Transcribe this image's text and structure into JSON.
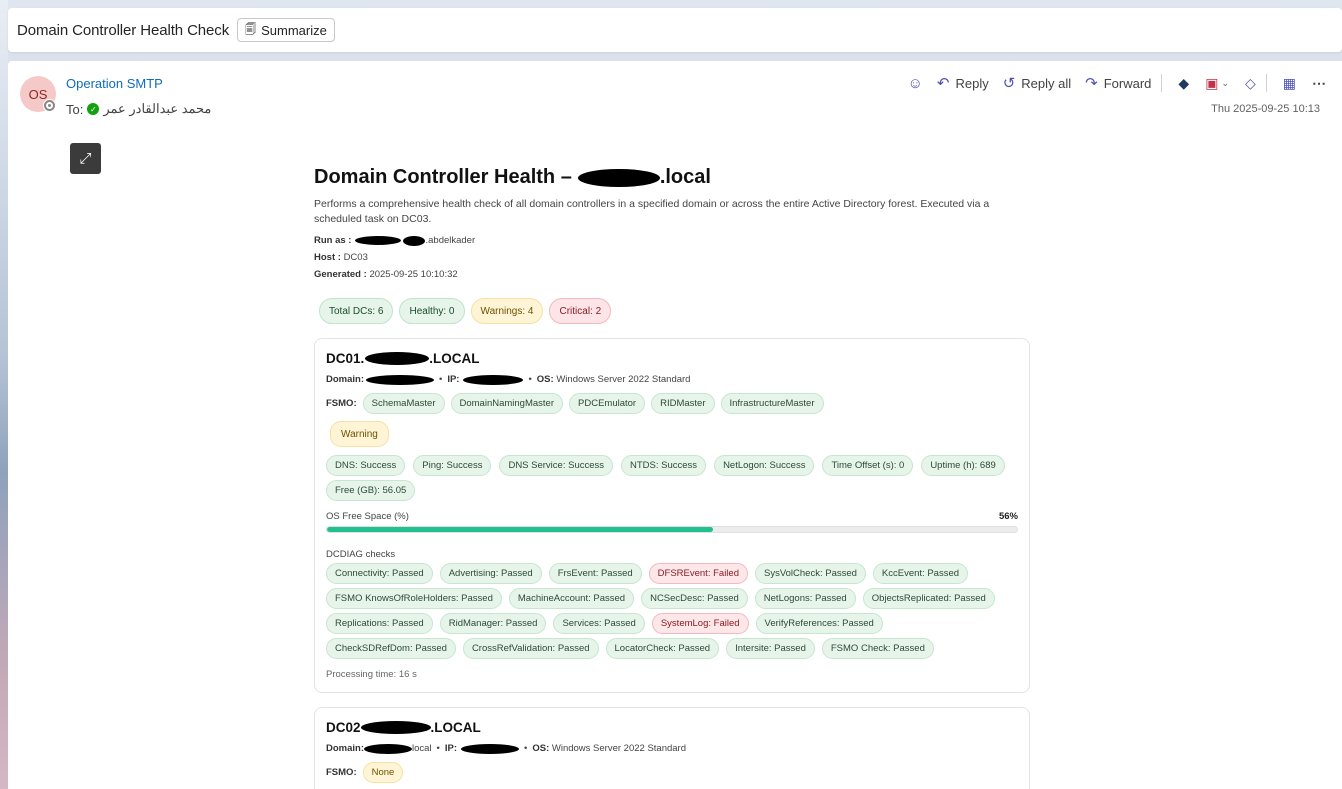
{
  "subject": "Domain Controller Health Check",
  "summarize_label": "Summarize",
  "sender": {
    "initials": "OS",
    "name": "Operation SMTP"
  },
  "to": {
    "label": "To:",
    "recipient": "محمد عبدالقادر عمر"
  },
  "date": "Thu 2025-09-25 10:13",
  "actions": {
    "reply": "Reply",
    "reply_all": "Reply all",
    "forward": "Forward"
  },
  "report": {
    "title_prefix": "Domain Controller Health –",
    "title_suffix": ".local",
    "description": "Performs a comprehensive health check of all domain controllers in a specified domain or across the entire Active Directory forest. Executed via a scheduled task on DC03.",
    "run_as_label": "Run as :",
    "run_as_suffix": ".abdelkader",
    "host_label": "Host :",
    "host": "DC03",
    "generated_label": "Generated :",
    "generated": "2025-09-25 10:10:32"
  },
  "summary": {
    "total": "Total DCs: 6",
    "healthy": "Healthy: 0",
    "warnings": "Warnings: 4",
    "critical": "Critical: 2"
  },
  "dc1": {
    "name_prefix": "DC01.",
    "name_suffix": ".LOCAL",
    "domain_label": "Domain:",
    "ip_label": "IP:",
    "os_label": "OS:",
    "os": "Windows Server 2022 Standard",
    "fsmo_label": "FSMO:",
    "fsmo": [
      "SchemaMaster",
      "DomainNamingMaster",
      "PDCEmulator",
      "RIDMaster",
      "InfrastructureMaster"
    ],
    "status": "Warning",
    "checks": [
      "DNS: Success",
      "Ping: Success",
      "DNS Service: Success",
      "NTDS: Success",
      "NetLogon: Success",
      "Time Offset (s): 0",
      "Uptime (h): 689",
      "Free (GB): 56.05"
    ],
    "free_space_label": "OS Free Space (%)",
    "free_space_text": "56%",
    "free_space_pct": 56,
    "dcdiag_label": "DCDIAG checks",
    "dcdiag": [
      {
        "text": "Connectivity: Passed",
        "state": "pass"
      },
      {
        "text": "Advertising: Passed",
        "state": "pass"
      },
      {
        "text": "FrsEvent: Passed",
        "state": "pass"
      },
      {
        "text": "DFSREvent: Failed",
        "state": "fail"
      },
      {
        "text": "SysVolCheck: Passed",
        "state": "pass"
      },
      {
        "text": "KccEvent: Passed",
        "state": "pass"
      },
      {
        "text": "FSMO KnowsOfRoleHolders: Passed",
        "state": "pass"
      },
      {
        "text": "MachineAccount: Passed",
        "state": "pass"
      },
      {
        "text": "NCSecDesc: Passed",
        "state": "pass"
      },
      {
        "text": "NetLogons: Passed",
        "state": "pass"
      },
      {
        "text": "ObjectsReplicated: Passed",
        "state": "pass"
      },
      {
        "text": "Replications: Passed",
        "state": "pass"
      },
      {
        "text": "RidManager: Passed",
        "state": "pass"
      },
      {
        "text": "Services: Passed",
        "state": "pass"
      },
      {
        "text": "SystemLog: Failed",
        "state": "fail"
      },
      {
        "text": "VerifyReferences: Passed",
        "state": "pass"
      },
      {
        "text": "CheckSDRefDom: Passed",
        "state": "pass"
      },
      {
        "text": "CrossRefValidation: Passed",
        "state": "pass"
      },
      {
        "text": "LocatorCheck: Passed",
        "state": "pass"
      },
      {
        "text": "Intersite: Passed",
        "state": "pass"
      },
      {
        "text": "FSMO Check: Passed",
        "state": "pass"
      }
    ],
    "processing_time": "Processing time: 16 s"
  },
  "dc2": {
    "name_prefix": "DC02",
    "name_suffix": ".LOCAL",
    "domain_label": "Domain:",
    "domain_suffix": "local",
    "ip_label": "IP:",
    "os_label": "OS:",
    "os": "Windows Server 2022 Standard",
    "fsmo_label": "FSMO:",
    "fsmo": [
      "None"
    ]
  }
}
